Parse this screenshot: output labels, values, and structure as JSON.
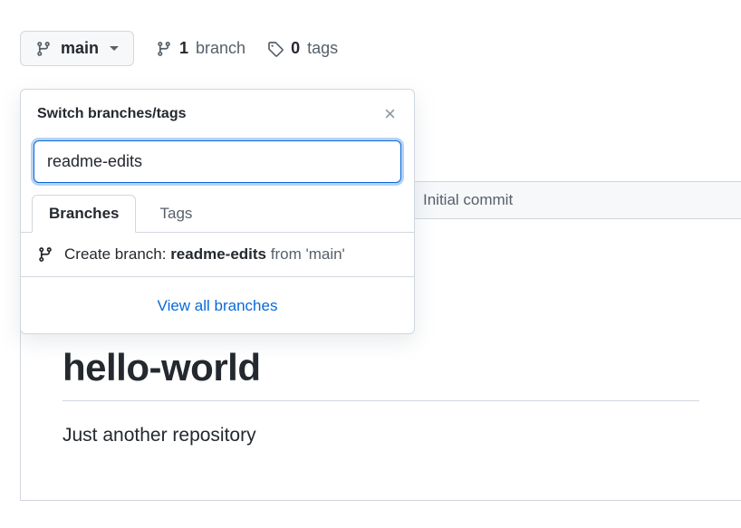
{
  "toolbar": {
    "branch_button_label": "main",
    "branch_count": "1",
    "branch_count_label": "branch",
    "tag_count": "0",
    "tag_count_label": "tags"
  },
  "popover": {
    "title": "Switch branches/tags",
    "search_value": "readme-edits",
    "tabs": {
      "branches": "Branches",
      "tags": "Tags"
    },
    "create_prefix": "Create branch: ",
    "create_branch_name": "readme-edits",
    "create_from": " from 'main'",
    "view_all": "View all branches"
  },
  "background": {
    "commit_msg": "Initial commit",
    "readme_title": "hello-world",
    "readme_body": "Just another repository"
  }
}
